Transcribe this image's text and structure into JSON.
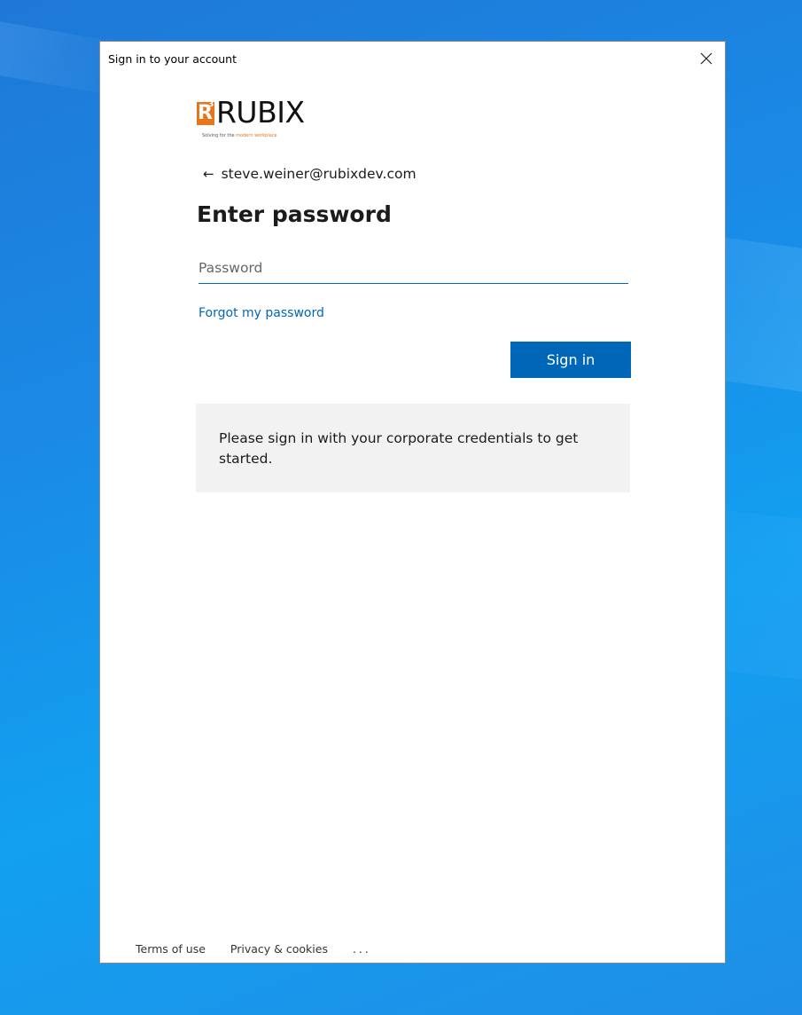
{
  "window": {
    "title": "Sign in to your account"
  },
  "logo": {
    "mark_letter": "R",
    "mark_superscript": "3",
    "wordmark": "RUBIX",
    "tagline_prefix": "Solving for the ",
    "tagline_highlight": "modern workplace",
    "brand_color": "#e8751a"
  },
  "account": {
    "back_icon": "back-arrow-icon",
    "email": "steve.weiner@rubixdev.com"
  },
  "form": {
    "heading": "Enter password",
    "password_placeholder": "Password",
    "password_value": "",
    "forgot_link": "Forgot my password",
    "signin_label": "Sign in",
    "accent_color": "#0067b8"
  },
  "notice": {
    "text": "Please sign in with your corporate credentials to get started."
  },
  "footer": {
    "terms": "Terms of use",
    "privacy": "Privacy & cookies",
    "more": "..."
  }
}
